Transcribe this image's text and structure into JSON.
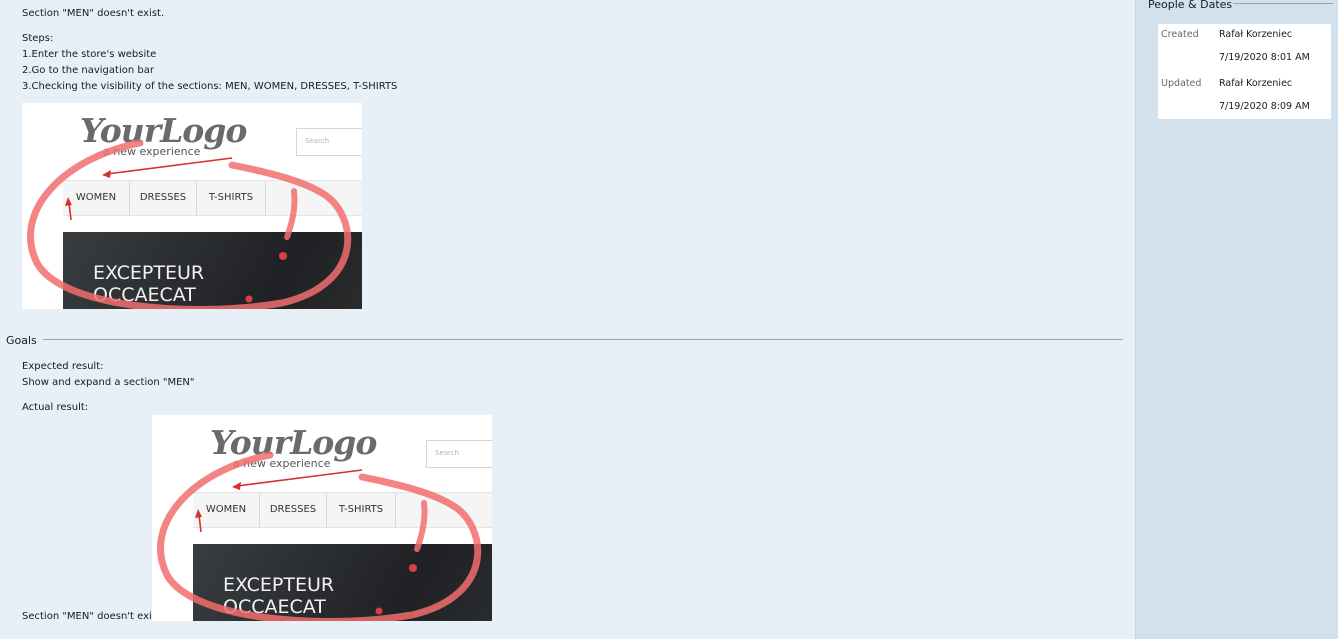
{
  "description": {
    "intro": "Section \"MEN\" doesn't exist.",
    "steps_label": "Steps:",
    "steps": [
      "1.Enter the store's website",
      "2.Go to the navigation bar",
      "3.Checking the visibility of the sections: MEN, WOMEN, DRESSES, T-SHIRTS"
    ]
  },
  "screenshot": {
    "logo": "YourLogo",
    "tagline": "a new experience",
    "search_placeholder": "Search",
    "nav": [
      "WOMEN",
      "DRESSES",
      "T-SHIRTS"
    ],
    "hero_line1": "EXCEPTEUR",
    "hero_line2": "OCCAECAT",
    "annotation_color": "#f26d6d"
  },
  "goals": {
    "heading": "Goals",
    "expected_label": "Expected result:",
    "expected_text": "Show and expand a section \"MEN\"",
    "actual_label": "Actual result:",
    "actual_text": "Section \"MEN\" doesn't exist."
  },
  "people_dates": {
    "heading": "People & Dates",
    "created_label": "Created",
    "created_by": "Rafał Korzeniec",
    "created_at": "7/19/2020 8:01 AM",
    "updated_label": "Updated",
    "updated_by": "Rafał Korzeniec",
    "updated_at": "7/19/2020 8:09 AM"
  }
}
